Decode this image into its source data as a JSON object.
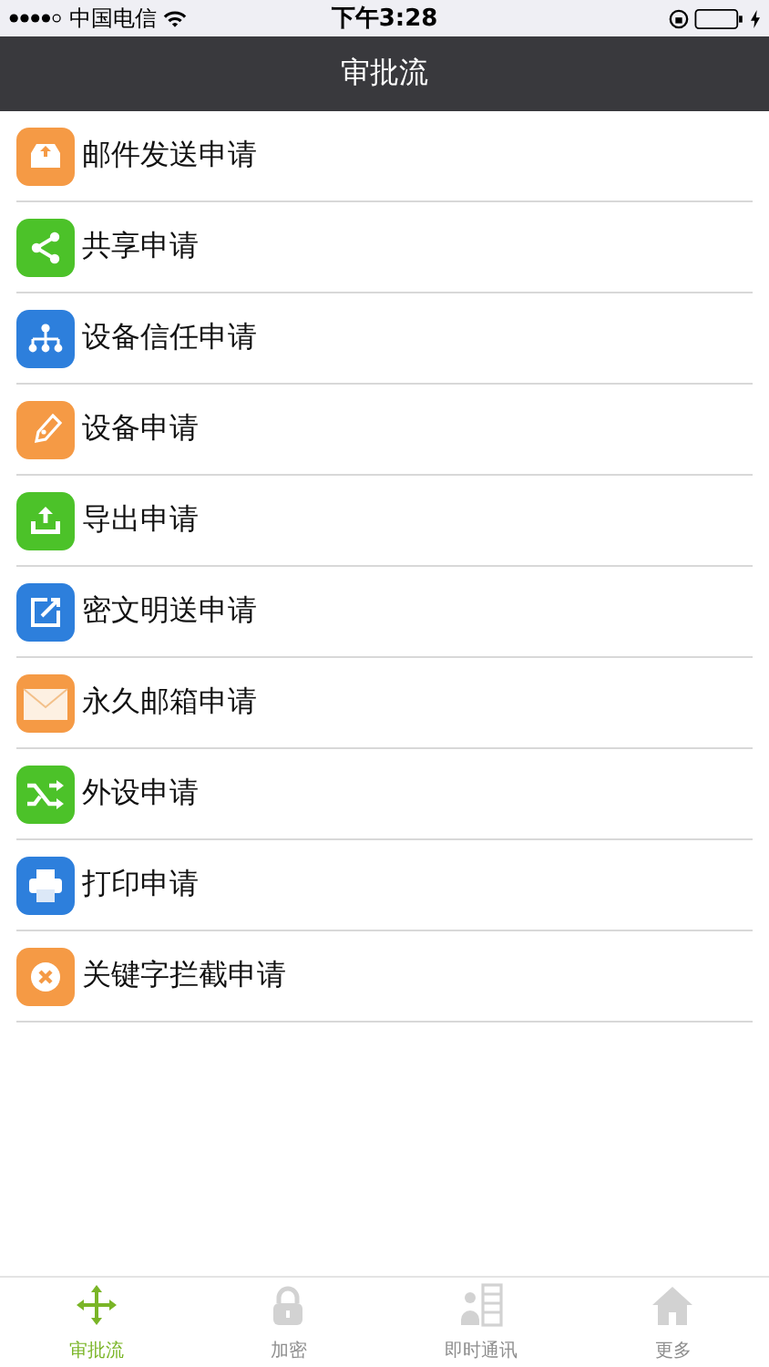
{
  "status_bar": {
    "carrier": "中国电信",
    "time": "下午3:28"
  },
  "nav_bar": {
    "title": "审批流"
  },
  "items": [
    {
      "label": "邮件发送申请",
      "kind": "outbox",
      "color": "#f59a45"
    },
    {
      "label": "共享申请",
      "kind": "share",
      "color": "#4cc229"
    },
    {
      "label": "设备信任申请",
      "kind": "sitemap",
      "color": "#2d7fdc"
    },
    {
      "label": "设备申请",
      "kind": "pen",
      "color": "#f59a45"
    },
    {
      "label": "导出申请",
      "kind": "upload",
      "color": "#4cc229"
    },
    {
      "label": "密文明送申请",
      "kind": "edit",
      "color": "#2d7fdc"
    },
    {
      "label": "永久邮箱申请",
      "kind": "mail",
      "color": "#f59a45"
    },
    {
      "label": "外设申请",
      "kind": "shuffle",
      "color": "#4cc229"
    },
    {
      "label": "打印申请",
      "kind": "printer",
      "color": "#2d7fdc"
    },
    {
      "label": "关键字拦截申请",
      "kind": "cross",
      "color": "#f59a45"
    }
  ],
  "tab_bar": [
    {
      "label": "审批流",
      "kind": "move",
      "selected": true
    },
    {
      "label": "加密",
      "kind": "lock",
      "selected": false
    },
    {
      "label": "即时通讯",
      "kind": "contacts",
      "selected": false
    },
    {
      "label": "更多",
      "kind": "home",
      "selected": false
    }
  ]
}
